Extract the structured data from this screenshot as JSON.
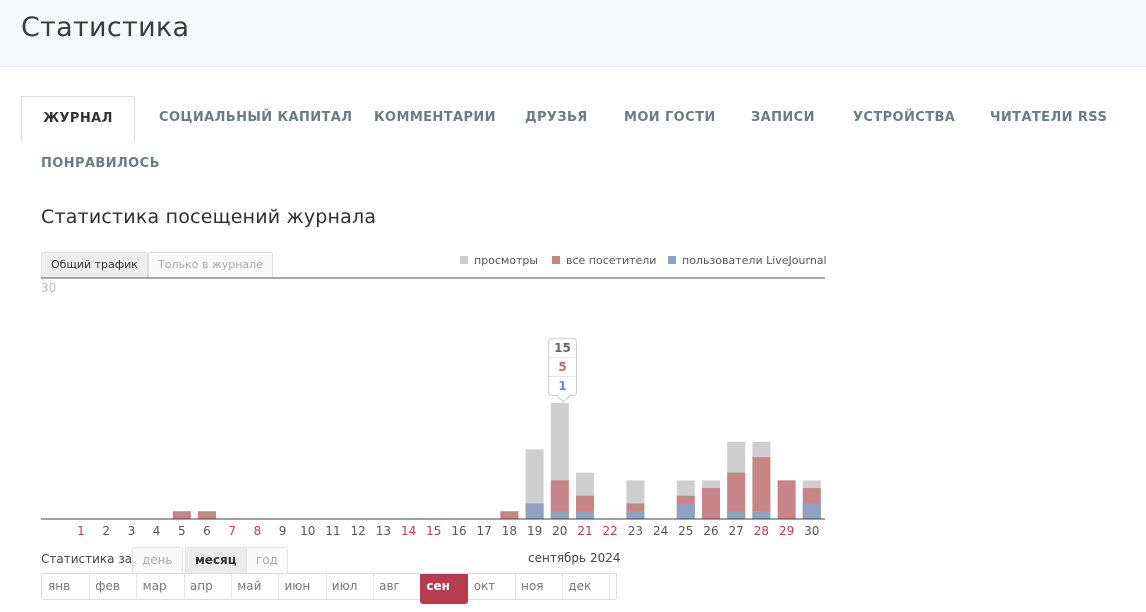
{
  "page": {
    "title": "Статистика"
  },
  "tabs": [
    {
      "label": "ЖУРНАЛ",
      "active": true
    },
    {
      "label": "СОЦИАЛЬНЫЙ КАПИТАЛ",
      "active": false
    },
    {
      "label": "КОММЕНТАРИИ",
      "active": false
    },
    {
      "label": "ДРУЗЬЯ",
      "active": false
    },
    {
      "label": "МОИ ГОСТИ",
      "active": false
    },
    {
      "label": "ЗАПИСИ",
      "active": false
    },
    {
      "label": "УСТРОЙСТВА",
      "active": false
    },
    {
      "label": "ЧИТАТЕЛИ RSS",
      "active": false
    },
    {
      "label": "ПОНРАВИЛОСЬ",
      "active": false
    }
  ],
  "section_title": "Статистика посещений журнала",
  "mode": {
    "total": "Общий трафик",
    "journal_only": "Только в журнале",
    "selected": "total"
  },
  "legend": {
    "views": "просмотры",
    "all_visitors": "все посетители",
    "lj_users": "пользователи LiveJournal"
  },
  "colors": {
    "views": "#cfcfcf",
    "all_visitors": "#c88587",
    "lj_users": "#8ea3c2",
    "weekend_label": "#b5414f",
    "accent": "#b73c4f"
  },
  "tooltip": {
    "day": "20",
    "views": "15",
    "all_visitors": "5",
    "lj_users": "1"
  },
  "period": {
    "label": "Статистика за",
    "day": "день",
    "month": "месяц",
    "year": "год",
    "selected": "month",
    "current": "сентябрь 2024"
  },
  "months": [
    "янв",
    "фев",
    "мар",
    "апр",
    "май",
    "июн",
    "июл",
    "авг",
    "сен",
    "окт",
    "ноя",
    "дек"
  ],
  "selected_month": "сен",
  "chart_data": {
    "type": "bar",
    "ymax_label": "30",
    "ylim": [
      0,
      30
    ],
    "categories": [
      "1",
      "2",
      "3",
      "4",
      "5",
      "6",
      "7",
      "8",
      "9",
      "10",
      "11",
      "12",
      "13",
      "14",
      "15",
      "16",
      "17",
      "18",
      "19",
      "20",
      "21",
      "22",
      "23",
      "24",
      "25",
      "26",
      "27",
      "28",
      "29",
      "30"
    ],
    "weekend_days": [
      "1",
      "7",
      "8",
      "14",
      "15",
      "21",
      "22",
      "28",
      "29"
    ],
    "series": [
      {
        "name": "просмотры",
        "values": [
          0,
          0,
          0,
          0,
          1,
          1,
          0,
          0,
          0,
          0,
          0,
          0,
          0,
          0,
          0,
          0,
          0,
          1,
          9,
          15,
          6,
          0,
          5,
          0,
          5,
          5,
          10,
          10,
          5,
          5
        ]
      },
      {
        "name": "все посетители",
        "values": [
          0,
          0,
          0,
          0,
          1,
          1,
          0,
          0,
          0,
          0,
          0,
          0,
          0,
          0,
          0,
          0,
          0,
          1,
          2,
          5,
          3,
          0,
          2,
          0,
          3,
          4,
          6,
          8,
          5,
          4
        ]
      },
      {
        "name": "пользователи LiveJournal",
        "values": [
          0,
          0,
          0,
          0,
          0,
          0,
          0,
          0,
          0,
          0,
          0,
          0,
          0,
          0,
          0,
          0,
          0,
          0,
          2,
          1,
          1,
          0,
          1,
          0,
          2,
          0,
          1,
          1,
          0,
          2
        ]
      }
    ]
  }
}
